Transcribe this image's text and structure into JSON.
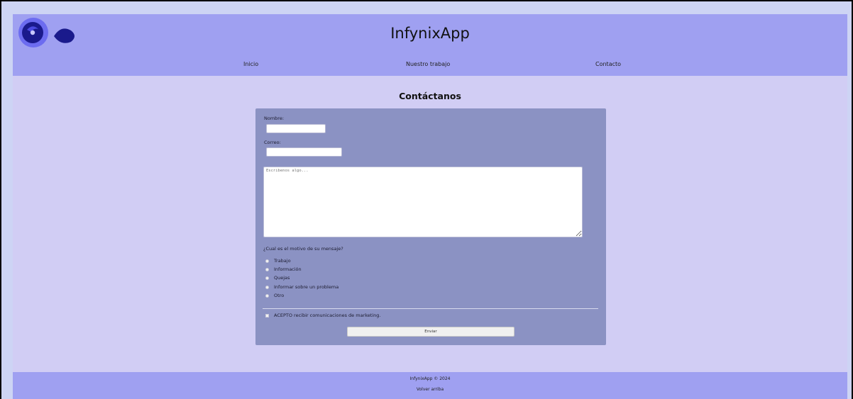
{
  "header": {
    "site_title": "InfynixApp",
    "nav": [
      "Inicio",
      "Nuestro trabajo",
      "Contacto"
    ]
  },
  "main": {
    "heading": "Contáctanos",
    "form": {
      "name_label": "Nombre:",
      "name_value": "",
      "email_label": "Correo:",
      "email_value": "",
      "message_placeholder": "Escribenos algo...",
      "reason_question": "¿Cual es el motivo de su mensaje?",
      "reasons": [
        "Trabajo",
        "Información",
        "Quejas",
        "Informar sobre un problema",
        "Otro"
      ],
      "marketing_consent": "ACEPTO recibir comunicaciones de marketing.",
      "submit_label": "Enviar"
    }
  },
  "footer": {
    "copyright": "InfynixApp © 2024",
    "back_to_top": "Volver arriba"
  },
  "colors": {
    "header_bg": "#9fa0f1",
    "page_bg": "#d1cdf4",
    "form_bg": "#8b92c3",
    "logo_dark": "#1a1a8c",
    "logo_light": "#6c6cf0"
  }
}
